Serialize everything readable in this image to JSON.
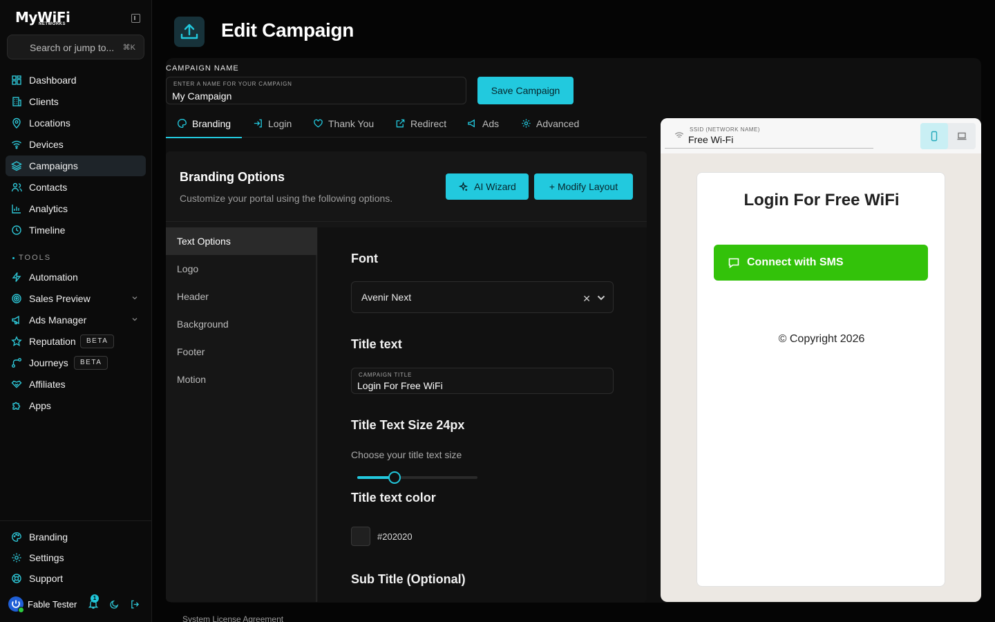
{
  "sidebar": {
    "logo": "MyWiFi",
    "logo_sub": "NETWORKS",
    "search_placeholder": "Search or jump to...",
    "search_shortcut": "⌘K",
    "items": [
      {
        "label": "Dashboard",
        "icon": "grid-icon"
      },
      {
        "label": "Clients",
        "icon": "building-icon"
      },
      {
        "label": "Locations",
        "icon": "map-pin-icon"
      },
      {
        "label": "Devices",
        "icon": "wifi-icon"
      },
      {
        "label": "Campaigns",
        "icon": "layers-icon",
        "active": true
      },
      {
        "label": "Contacts",
        "icon": "users-icon"
      },
      {
        "label": "Analytics",
        "icon": "bar-chart-icon"
      },
      {
        "label": "Timeline",
        "icon": "clock-icon"
      }
    ],
    "tools_heading": "TOOLS",
    "tools": [
      {
        "label": "Automation",
        "icon": "bolt-icon"
      },
      {
        "label": "Sales Preview",
        "icon": "target-icon",
        "expandable": true
      },
      {
        "label": "Ads Manager",
        "icon": "megaphone-icon",
        "expandable": true
      },
      {
        "label": "Reputation",
        "icon": "star-icon",
        "badge": "BETA"
      },
      {
        "label": "Journeys",
        "icon": "route-icon",
        "badge": "BETA"
      },
      {
        "label": "Affiliates",
        "icon": "handshake-icon"
      },
      {
        "label": "Apps",
        "icon": "puzzle-icon"
      }
    ],
    "bottom": [
      {
        "label": "Branding",
        "icon": "palette-icon"
      },
      {
        "label": "Settings",
        "icon": "gear-icon"
      },
      {
        "label": "Support",
        "icon": "lifebuoy-icon"
      }
    ],
    "user_name": "Fable Tester",
    "notification_count": "1"
  },
  "header": {
    "title": "Edit Campaign"
  },
  "campaign": {
    "name_label": "CAMPAIGN NAME",
    "name_hint": "ENTER A NAME FOR YOUR CAMPAIGN",
    "name_value": "My Campaign",
    "save_label": "Save Campaign"
  },
  "tabs": [
    {
      "label": "Branding",
      "icon": "palette-icon",
      "active": true
    },
    {
      "label": "Login",
      "icon": "login-icon"
    },
    {
      "label": "Thank You",
      "icon": "heart-icon"
    },
    {
      "label": "Redirect",
      "icon": "external-link-icon"
    },
    {
      "label": "Ads",
      "icon": "megaphone-icon"
    },
    {
      "label": "Advanced",
      "icon": "gear-icon"
    }
  ],
  "branding": {
    "title": "Branding Options",
    "subtitle": "Customize your portal using the following options.",
    "ai_wizard_label": "AI Wizard",
    "modify_layout_label": "+ Modify Layout",
    "submenu": [
      "Text Options",
      "Logo",
      "Header",
      "Background",
      "Footer",
      "Motion"
    ],
    "font_heading": "Font",
    "font_value": "Avenir Next",
    "title_text_heading": "Title text",
    "campaign_title_hint": "CAMPAIGN TITLE",
    "campaign_title_value": "Login For Free WiFi",
    "title_size_heading": "Title Text Size 24px",
    "title_size_hint": "Choose your title text size",
    "title_size_fraction": 0.31,
    "title_color_heading": "Title text color",
    "title_color": "#202020",
    "subtitle_heading": "Sub Title (Optional)"
  },
  "preview": {
    "ssid_label": "SSID (NETWORK NAME)",
    "ssid_value": "Free Wi-Fi",
    "portal_title": "Login For Free WiFi",
    "sms_button": "Connect with SMS",
    "copyright": "© Copyright 2026",
    "sms_color": "#33c20a"
  },
  "footer": {
    "license_link": "System License Agreement"
  },
  "colors": {
    "accent": "#22c9de"
  }
}
